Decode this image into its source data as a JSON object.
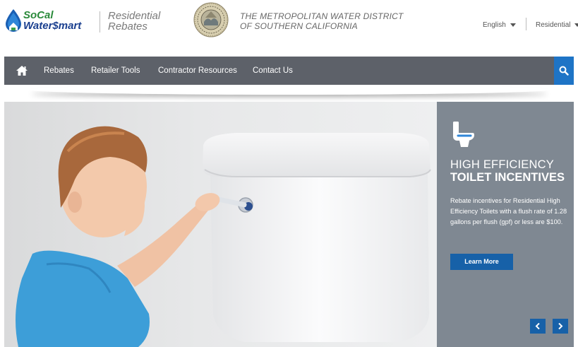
{
  "header": {
    "logo_line1": "SoCal",
    "logo_line2": "Water$mart",
    "program_line1": "Residential",
    "program_line2": "Rebates",
    "district_line1": "THE METROPOLITAN WATER DISTRICT",
    "district_line2": "OF SOUTHERN CALIFORNIA",
    "language": "English",
    "audience": "Residential"
  },
  "nav": {
    "items": [
      {
        "label": "Rebates"
      },
      {
        "label": "Retailer Tools"
      },
      {
        "label": "Contractor Resources"
      },
      {
        "label": "Contact Us"
      }
    ]
  },
  "hero": {
    "title_line1": "HIGH EFFICIENCY",
    "title_line2": "TOILET INCENTIVES",
    "description": "Rebate incentives for Residential High Efficiency Toilets with a flush rate of 1.28 gallons per flush (gpf) or less are $100.",
    "button_label": "Learn More"
  },
  "colors": {
    "nav_bg": "#5d6169",
    "search_bg": "#1e74c6",
    "panel_bg": "#7f8892",
    "button_bg": "#1761a8",
    "logo_green": "#2a8a3a",
    "logo_blue": "#1a3f8f"
  },
  "icons": [
    "water-drop-logo-icon",
    "home-icon",
    "search-icon",
    "toilet-icon",
    "chevron-left-icon",
    "chevron-right-icon",
    "caret-down-icon"
  ]
}
